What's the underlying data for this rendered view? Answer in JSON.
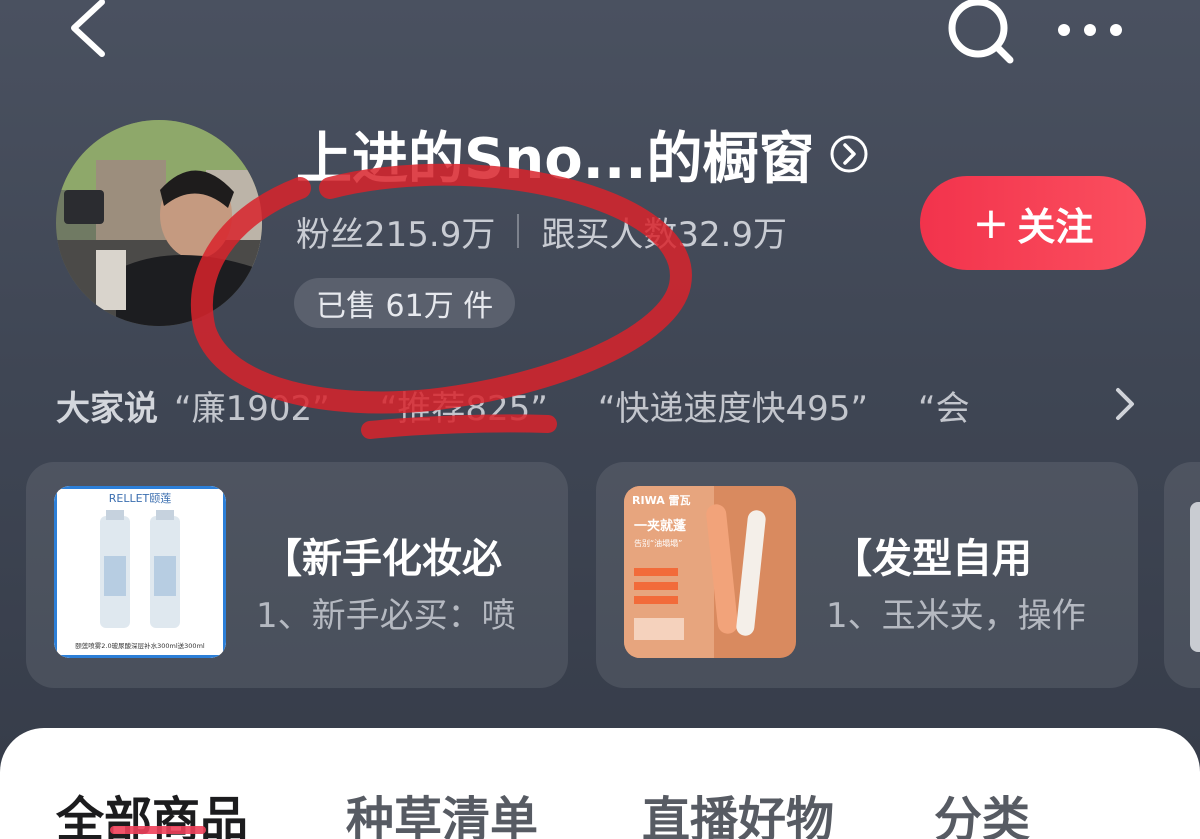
{
  "header": {
    "back_icon": "chevron-left-icon",
    "search_icon": "search-icon",
    "more_icon": "more-dots-icon"
  },
  "shop": {
    "title": "上进的Sno...的橱窗",
    "fans": "粉丝215.9万",
    "followers_buy": "跟买人数32.9万",
    "sold": "已售 61万 件",
    "follow_plus": "+",
    "follow_label": "关注"
  },
  "reviews": {
    "label": "大家说",
    "tags": [
      "“廉1902”",
      "“推荐825”",
      "“快递速度快495”",
      "“会"
    ]
  },
  "cards": [
    {
      "title": "【新手化妆必",
      "subtitle": "1、新手必买：喷",
      "image_brand": "RELLET颐莲",
      "image_caption": "颐莲喷雾2.0玻尿酸深层补水300ml送300ml"
    },
    {
      "title": "【发型自用",
      "subtitle": "1、玉米夹，操作",
      "image_brand": "RIWA 雷瓦",
      "image_caption": "一夹就蓬",
      "image_caption2": "告别“油塌塌”"
    }
  ],
  "tabs": [
    {
      "label": "全部商品",
      "active": true
    },
    {
      "label": "种草清单",
      "active": false
    },
    {
      "label": "直播好物",
      "active": false
    },
    {
      "label": "分类",
      "active": false
    }
  ],
  "colors": {
    "background": "#424958",
    "follow_button": "#f2334c",
    "annotation_red": "#d8232b",
    "tab_underline": "#f0405a"
  }
}
